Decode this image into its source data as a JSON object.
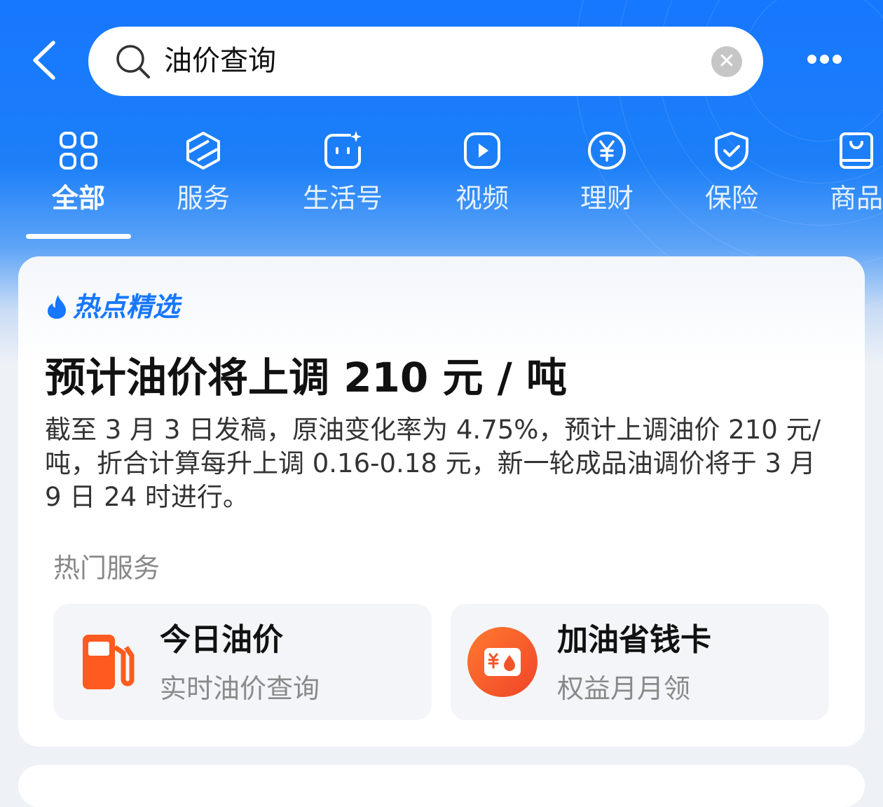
{
  "header": {
    "search_query": "油价查询"
  },
  "tabs": [
    {
      "label": "全部",
      "icon": "grid-icon",
      "active": true
    },
    {
      "label": "服务",
      "icon": "service-cube-icon",
      "active": false
    },
    {
      "label": "生活号",
      "icon": "life-account-icon",
      "active": false
    },
    {
      "label": "视频",
      "icon": "video-play-icon",
      "active": false
    },
    {
      "label": "理财",
      "icon": "yen-coin-icon",
      "active": false
    },
    {
      "label": "保险",
      "icon": "shield-check-icon",
      "active": false
    },
    {
      "label": "商品",
      "icon": "shopping-bag-icon",
      "active": false
    }
  ],
  "card": {
    "badge": "热点精选",
    "headline": "预计油价将上调 210 元 / 吨",
    "summary": "截至 3 月 3 日发稿，原油变化率为 4.75%，预计上调油价 210 元/吨，折合计算每升上调 0.16-0.18 元，新一轮成品油调价将于 3 月 9 日 24 时进行。",
    "section_label": "热门服务",
    "services": [
      {
        "title": "今日油价",
        "subtitle": "实时油价查询",
        "icon": "fuel-pump-icon"
      },
      {
        "title": "加油省钱卡",
        "subtitle": "权益月月领",
        "icon": "fuel-card-icon"
      }
    ]
  },
  "colors": {
    "brand_blue": "#1677ff",
    "fuel_orange": "#ff5a1f"
  }
}
